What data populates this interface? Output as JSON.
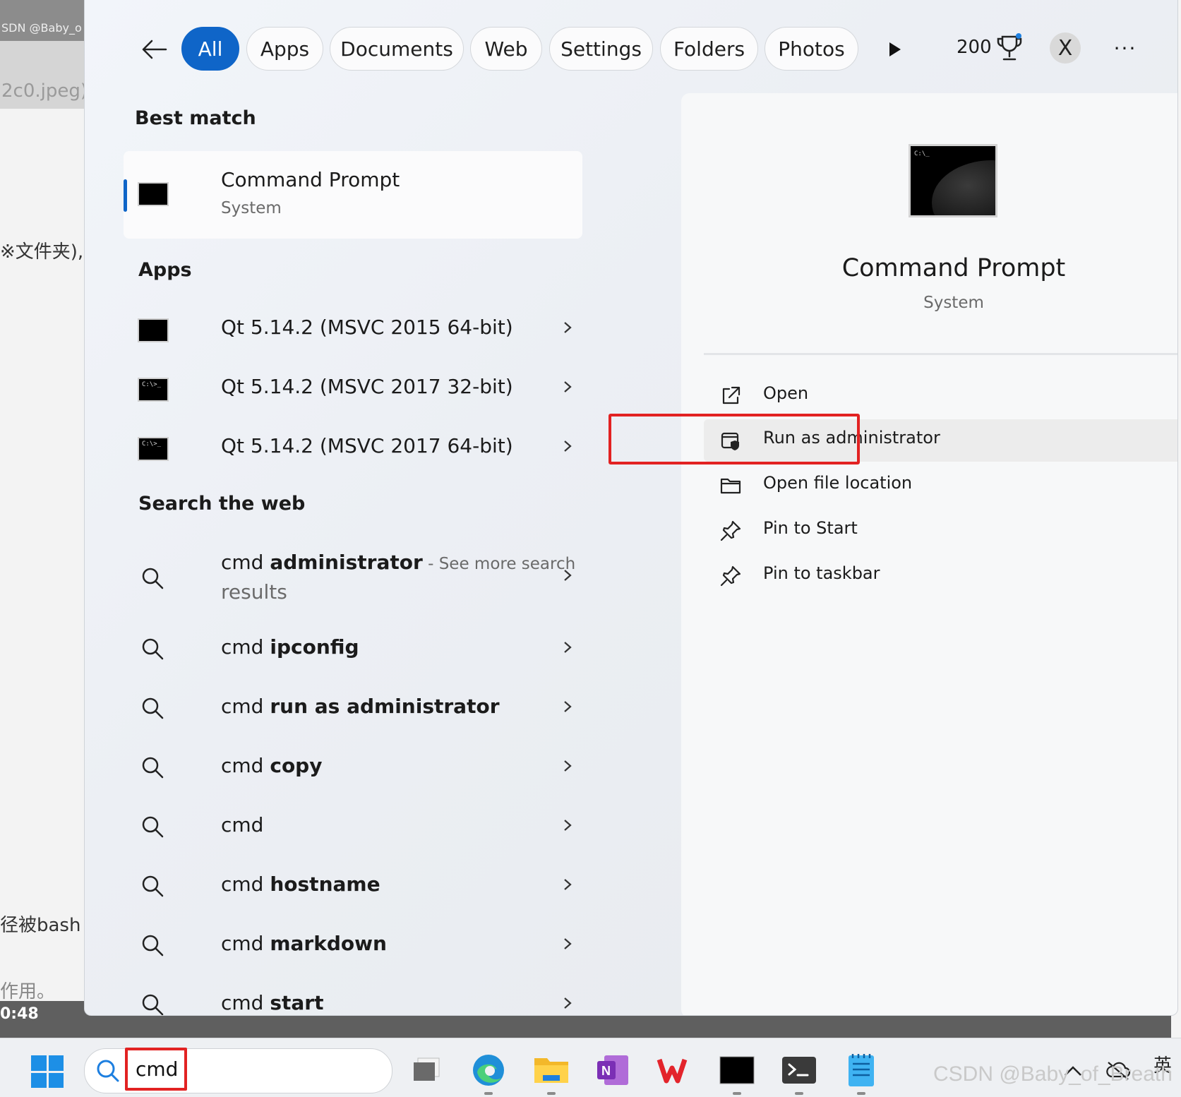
{
  "background": {
    "watermark_top": "SDN @Baby_o",
    "file_text": "2c0.jpeg)",
    "lines": [
      "※文件夹),",
      "径被bash",
      "作用。"
    ],
    "time": "0:48"
  },
  "search": {
    "tabs": [
      "All",
      "Apps",
      "Documents",
      "Web",
      "Settings",
      "Folders",
      "Photos"
    ],
    "active_tab": "All",
    "points": "200",
    "avatar_letter": "X",
    "more_label": "···"
  },
  "best_match": {
    "header": "Best match",
    "title": "Command Prompt",
    "subtitle": "System"
  },
  "apps": {
    "header": "Apps",
    "items": [
      {
        "label": "Qt 5.14.2 (MSVC 2015 64-bit)"
      },
      {
        "label": "Qt 5.14.2 (MSVC 2017 32-bit)"
      },
      {
        "label": "Qt 5.14.2 (MSVC 2017 64-bit)"
      }
    ]
  },
  "web": {
    "header": "Search the web",
    "first": {
      "prefix": "cmd ",
      "bold": "administrator",
      "suffix": " - See more search",
      "line2": "results"
    },
    "items": [
      {
        "prefix": "cmd ",
        "bold": "ipconfig"
      },
      {
        "prefix": "cmd ",
        "bold": "run as administrator"
      },
      {
        "prefix": "cmd ",
        "bold": "copy"
      },
      {
        "prefix": "cmd",
        "bold": ""
      },
      {
        "prefix": "cmd ",
        "bold": "hostname"
      },
      {
        "prefix": "cmd ",
        "bold": "markdown"
      },
      {
        "prefix": "cmd ",
        "bold": "start"
      }
    ]
  },
  "preview": {
    "title": "Command Prompt",
    "subtitle": "System",
    "actions": [
      "Open",
      "Run as administrator",
      "Open file location",
      "Pin to Start",
      "Pin to taskbar"
    ]
  },
  "taskbar": {
    "query": "cmd",
    "tray_lang": "英",
    "watermark": "CSDN @Baby_of_Breath"
  },
  "colors": {
    "accent": "#0f65c8",
    "highlight": "#e22222"
  }
}
